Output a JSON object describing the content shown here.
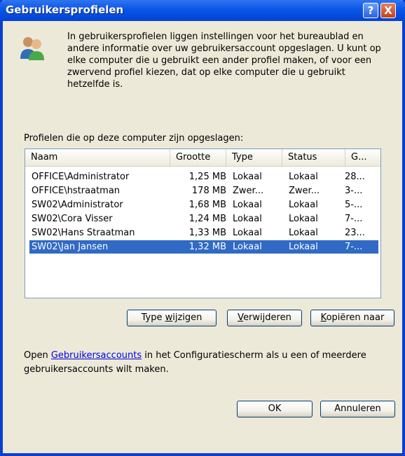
{
  "window": {
    "title": "Gebruikersprofielen",
    "help_button": "?",
    "close_button": "X"
  },
  "intro_text": "In gebruikersprofielen liggen instellingen voor het bureaublad en andere informatie over uw gebruikersaccount opgeslagen. U kunt op elke computer die u gebruikt een ander profiel maken, of voor een zwervend profiel kiezen, dat op elke computer die u gebruikt hetzelfde is.",
  "profiles_label": "Profielen die op deze computer zijn opgeslagen:",
  "columns": {
    "naam": "Naam",
    "grootte": "Grootte",
    "type": "Type",
    "status": "Status",
    "g": "G..."
  },
  "rows": [
    {
      "naam": "OFFICE\\Administrator",
      "grootte": "1,25 MB",
      "type": "Lokaal",
      "status": "Lokaal",
      "g": "28...",
      "selected": false
    },
    {
      "naam": "OFFICE\\hstraatman",
      "grootte": "178 MB",
      "type": "Zwer...",
      "status": "Zwer...",
      "g": "3-...",
      "selected": false
    },
    {
      "naam": "SW02\\Administrator",
      "grootte": "1,68 MB",
      "type": "Lokaal",
      "status": "Lokaal",
      "g": "5-...",
      "selected": false
    },
    {
      "naam": "SW02\\Cora Visser",
      "grootte": "1,24 MB",
      "type": "Lokaal",
      "status": "Lokaal",
      "g": "7-...",
      "selected": false
    },
    {
      "naam": "SW02\\Hans Straatman",
      "grootte": "1,33 MB",
      "type": "Lokaal",
      "status": "Lokaal",
      "g": "23...",
      "selected": false
    },
    {
      "naam": "SW02\\Jan Jansen",
      "grootte": "1,32 MB",
      "type": "Lokaal",
      "status": "Lokaal",
      "g": "7-...",
      "selected": true
    }
  ],
  "buttons": {
    "type_wijzigen_pre": "Type ",
    "type_wijzigen_u": "w",
    "type_wijzigen_post": "ijzigen",
    "verwijderen_u": "V",
    "verwijderen_post": "erwijderen",
    "kopieren_u": "K",
    "kopieren_post": "opiëren naar",
    "ok": "OK",
    "annuleren": "Annuleren"
  },
  "footer": {
    "pre": "Open ",
    "link": "Gebruikersaccounts",
    "post": " in het Configuratiescherm als u een of meerdere gebruikersaccounts wilt maken."
  },
  "colors": {
    "titlebar": "#0a56e8",
    "selection": "#316ac5",
    "dialog_bg": "#ece9d8"
  }
}
